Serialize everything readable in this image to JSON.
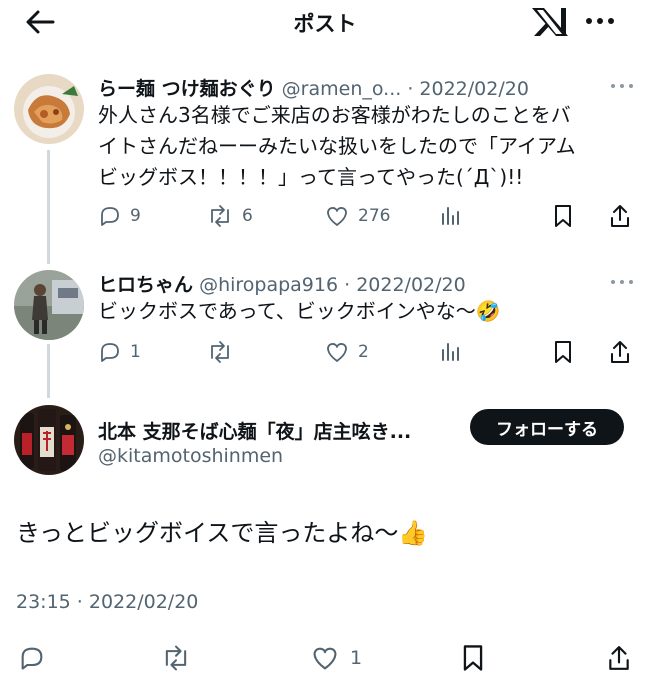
{
  "topbar": {
    "title": "ポスト"
  },
  "posts": [
    {
      "name": "らー麺 つけ麺おぐり",
      "handle": "@ramen_o...",
      "date": "· 2022/02/20",
      "lines": [
        "外人さん3名様でご来店のお客様がわたしのことをバ",
        "イトさんだねーーみたいな扱いをしたので「アイアム",
        "ビッグボス！！！！」って言ってやった(´Д`)!!"
      ],
      "stats": {
        "replies": "9",
        "reposts": "6",
        "likes": "276"
      }
    },
    {
      "name": "ヒロちゃん",
      "handle": "@hiropapa916",
      "date": "· 2022/02/20",
      "lines": [
        "ビックボスであって、ビックボインやな〜🤣"
      ],
      "stats": {
        "replies": "1",
        "reposts": "",
        "likes": "2"
      }
    }
  ],
  "main_post": {
    "name": "北本 支那そば心麺「夜」店主呟き...",
    "handle": "@kitamotoshinmen",
    "follow_label": "フォローする",
    "text": "きっとビッグボイスで言ったよね〜👍",
    "timestamp": "23:15 · 2022/02/20",
    "likes": "1"
  },
  "icons": {
    "back": "arrow-left-icon",
    "logo": "x-logo-icon",
    "more": "more-dots-icon",
    "reply": "reply-icon",
    "repost": "repost-icon",
    "like": "heart-icon",
    "views": "views-icon",
    "bookmark": "bookmark-icon",
    "share": "share-icon"
  },
  "colors": {
    "text": "#0f1419",
    "secondary": "#536471",
    "line": "#cfd9de",
    "button": "#0f1419"
  }
}
